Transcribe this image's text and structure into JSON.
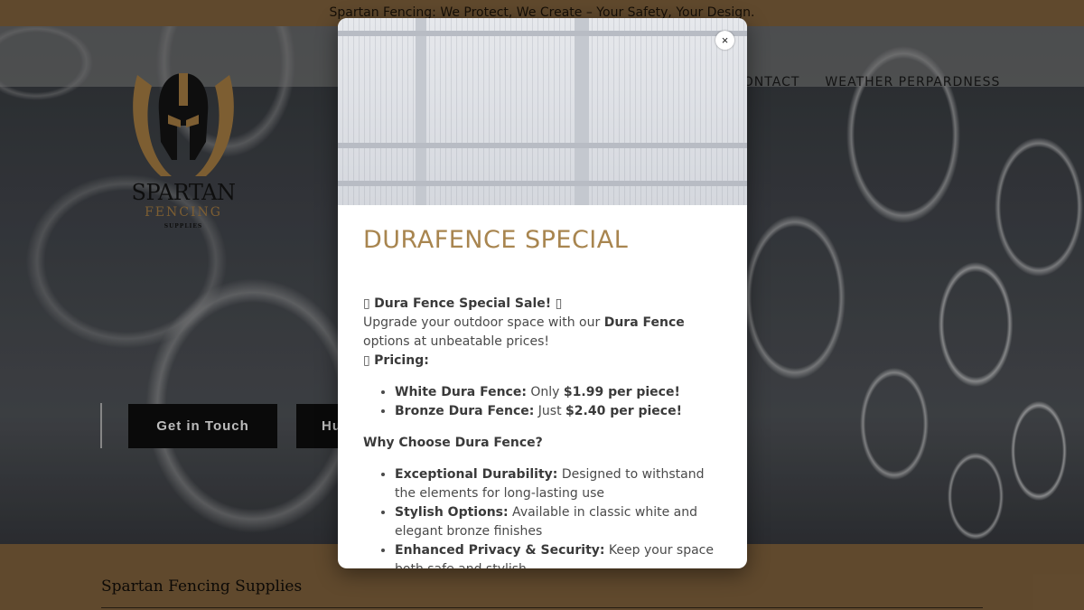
{
  "announcement": "Spartan Fencing: We Protect, We Create – Your Safety, Your Design.",
  "logo": {
    "name": "SPARTAN",
    "sub1": "FENCING",
    "sub2": "SUPPLIES"
  },
  "nav": {
    "items": [
      "CONTACT",
      "WEATHER PERPARDNESS"
    ]
  },
  "hero": {
    "buttons": {
      "touch": "Get in Touch",
      "partial": "Hu"
    }
  },
  "footer": {
    "title": "Spartan Fencing Supplies"
  },
  "modal": {
    "close_glyph": "×",
    "title": "DURAFENCE SPECIAL",
    "sale_emoji": "▯",
    "sale_heading": "Dura Fence Special Sale!",
    "intro_pre": "Upgrade your outdoor space with our ",
    "intro_bold": "Dura Fence",
    "intro_post": " options at unbeatable prices!",
    "pricing_heading": "Pricing:",
    "pricing": [
      {
        "label": "White Dura Fence:",
        "pre": " Only ",
        "price": "$1.99 per piece!"
      },
      {
        "label": "Bronze Dura Fence:",
        "pre": " Just ",
        "price": "$2.40 per piece!"
      }
    ],
    "why_heading": "Why Choose Dura Fence?",
    "reasons": [
      {
        "label": "Exceptional Durability:",
        "text": " Designed to withstand the elements for long-lasting use"
      },
      {
        "label": "Stylish Options:",
        "text": " Available in classic white and elegant bronze finishes"
      },
      {
        "label": "Enhanced Privacy & Security:",
        "text": " Keep your space both safe and stylish"
      }
    ]
  },
  "colors": {
    "brand_brown": "#6e5434",
    "title_gold": "#a8854f"
  }
}
